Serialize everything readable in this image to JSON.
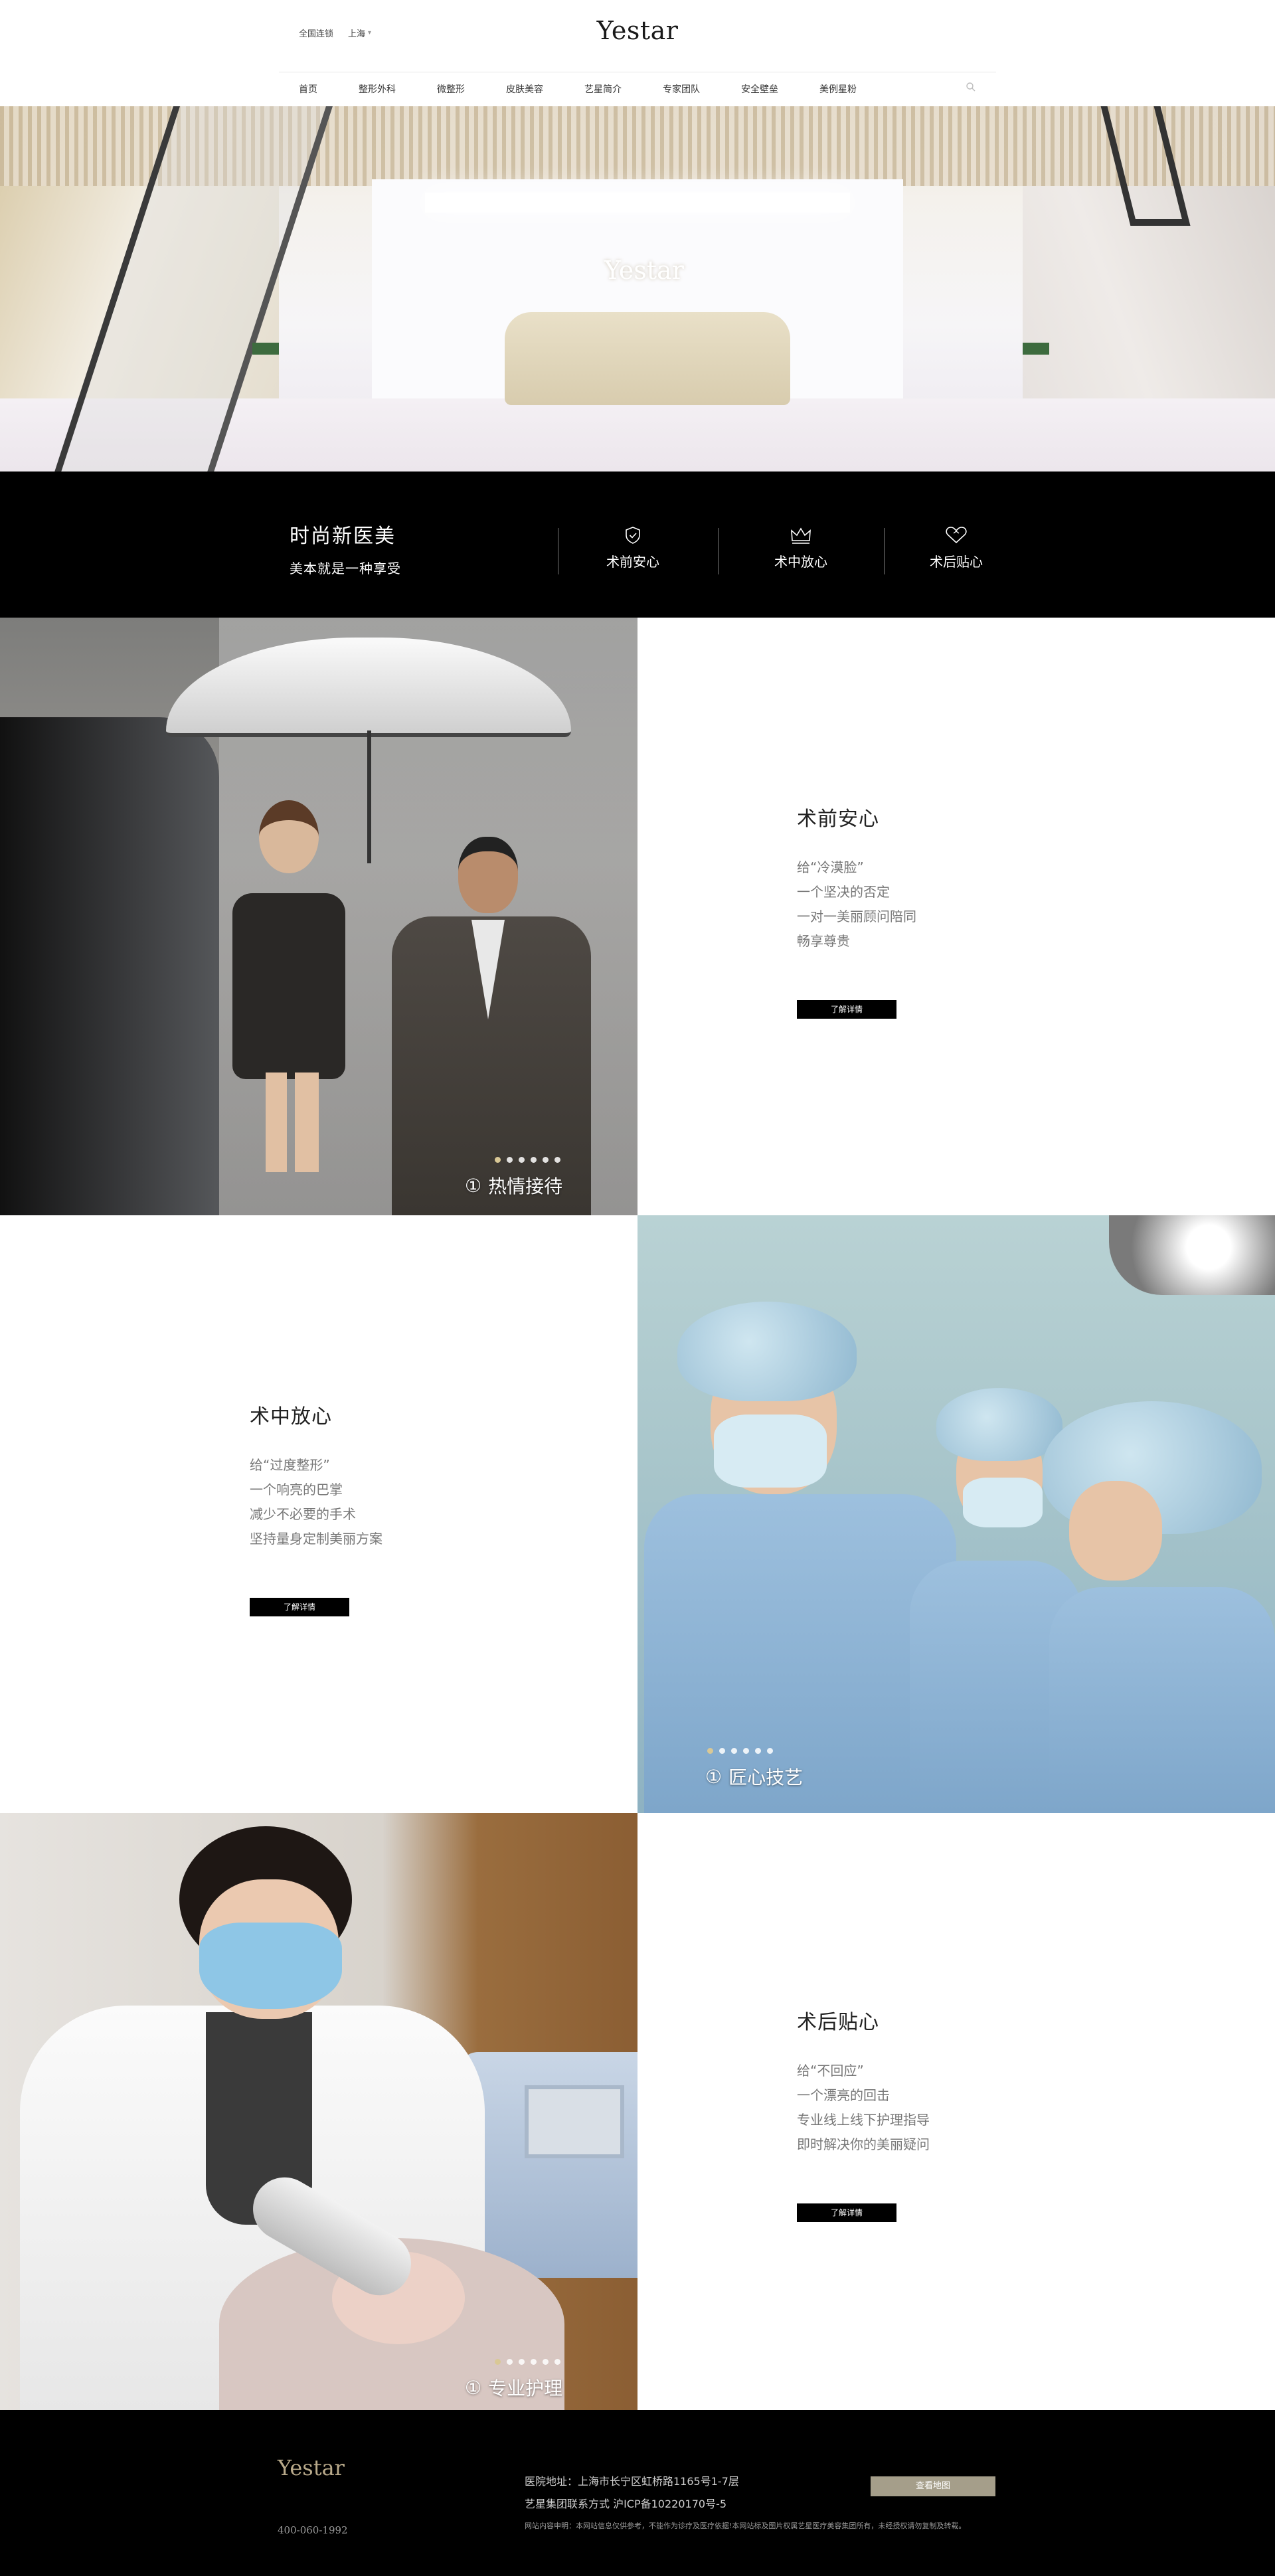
{
  "header": {
    "region_label": "全国连锁",
    "city": "上海",
    "logo": "Yestar",
    "nav": [
      "首页",
      "整形外科",
      "微整形",
      "皮肤美容",
      "艺星简介",
      "专家团队",
      "安全壁垒",
      "美例星粉"
    ]
  },
  "hero": {
    "logo": "Yestar"
  },
  "band": {
    "title": "时尚新医美",
    "subtitle": "美本就是一种享受",
    "features": [
      {
        "label": "术前安心",
        "icon": "shield-check-icon"
      },
      {
        "label": "术中放心",
        "icon": "crown-icon"
      },
      {
        "label": "术后贴心",
        "icon": "heart-icon"
      }
    ]
  },
  "sections": [
    {
      "title": "术前安心",
      "lines": [
        "给“冷漠脸”",
        "一个坚决的否定",
        "一对一美丽顾问陪同",
        "畅享尊贵"
      ],
      "button": "了解详情",
      "caption_num": "①",
      "caption": "热情接待",
      "dots_total": 6,
      "dot_active": 1
    },
    {
      "title": "术中放心",
      "lines": [
        "给“过度整形”",
        "一个响亮的巴掌",
        "减少不必要的手术",
        "坚持量身定制美丽方案"
      ],
      "button": "了解详情",
      "caption_num": "①",
      "caption": "匠心技艺",
      "dots_total": 6,
      "dot_active": 1
    },
    {
      "title": "术后贴心",
      "lines": [
        "给“不回应”",
        "一个漂亮的回击",
        "专业线上线下护理指导",
        "即时解决你的美丽疑问"
      ],
      "button": "了解详情",
      "caption_num": "①",
      "caption": "专业护理",
      "dots_total": 6,
      "dot_active": 1
    }
  ],
  "footer": {
    "logo": "Yestar",
    "phone": "400-060-1992",
    "address": "医院地址：上海市长宁区虹桥路1165号1-7层",
    "contact": "艺星集团联系方式 沪ICP备10220170号-5",
    "disclaimer": "网站内容申明：本网站信息仅供参考，不能作为诊疗及医疗依据!本网站标及图片权属艺星医疗美容集团所有，未经授权请勿复制及转载。",
    "map_button": "查看地图"
  },
  "colors": {
    "accent_gold": "#d9c896",
    "map_button": "#a59e8a",
    "band_bg": "#000000"
  }
}
